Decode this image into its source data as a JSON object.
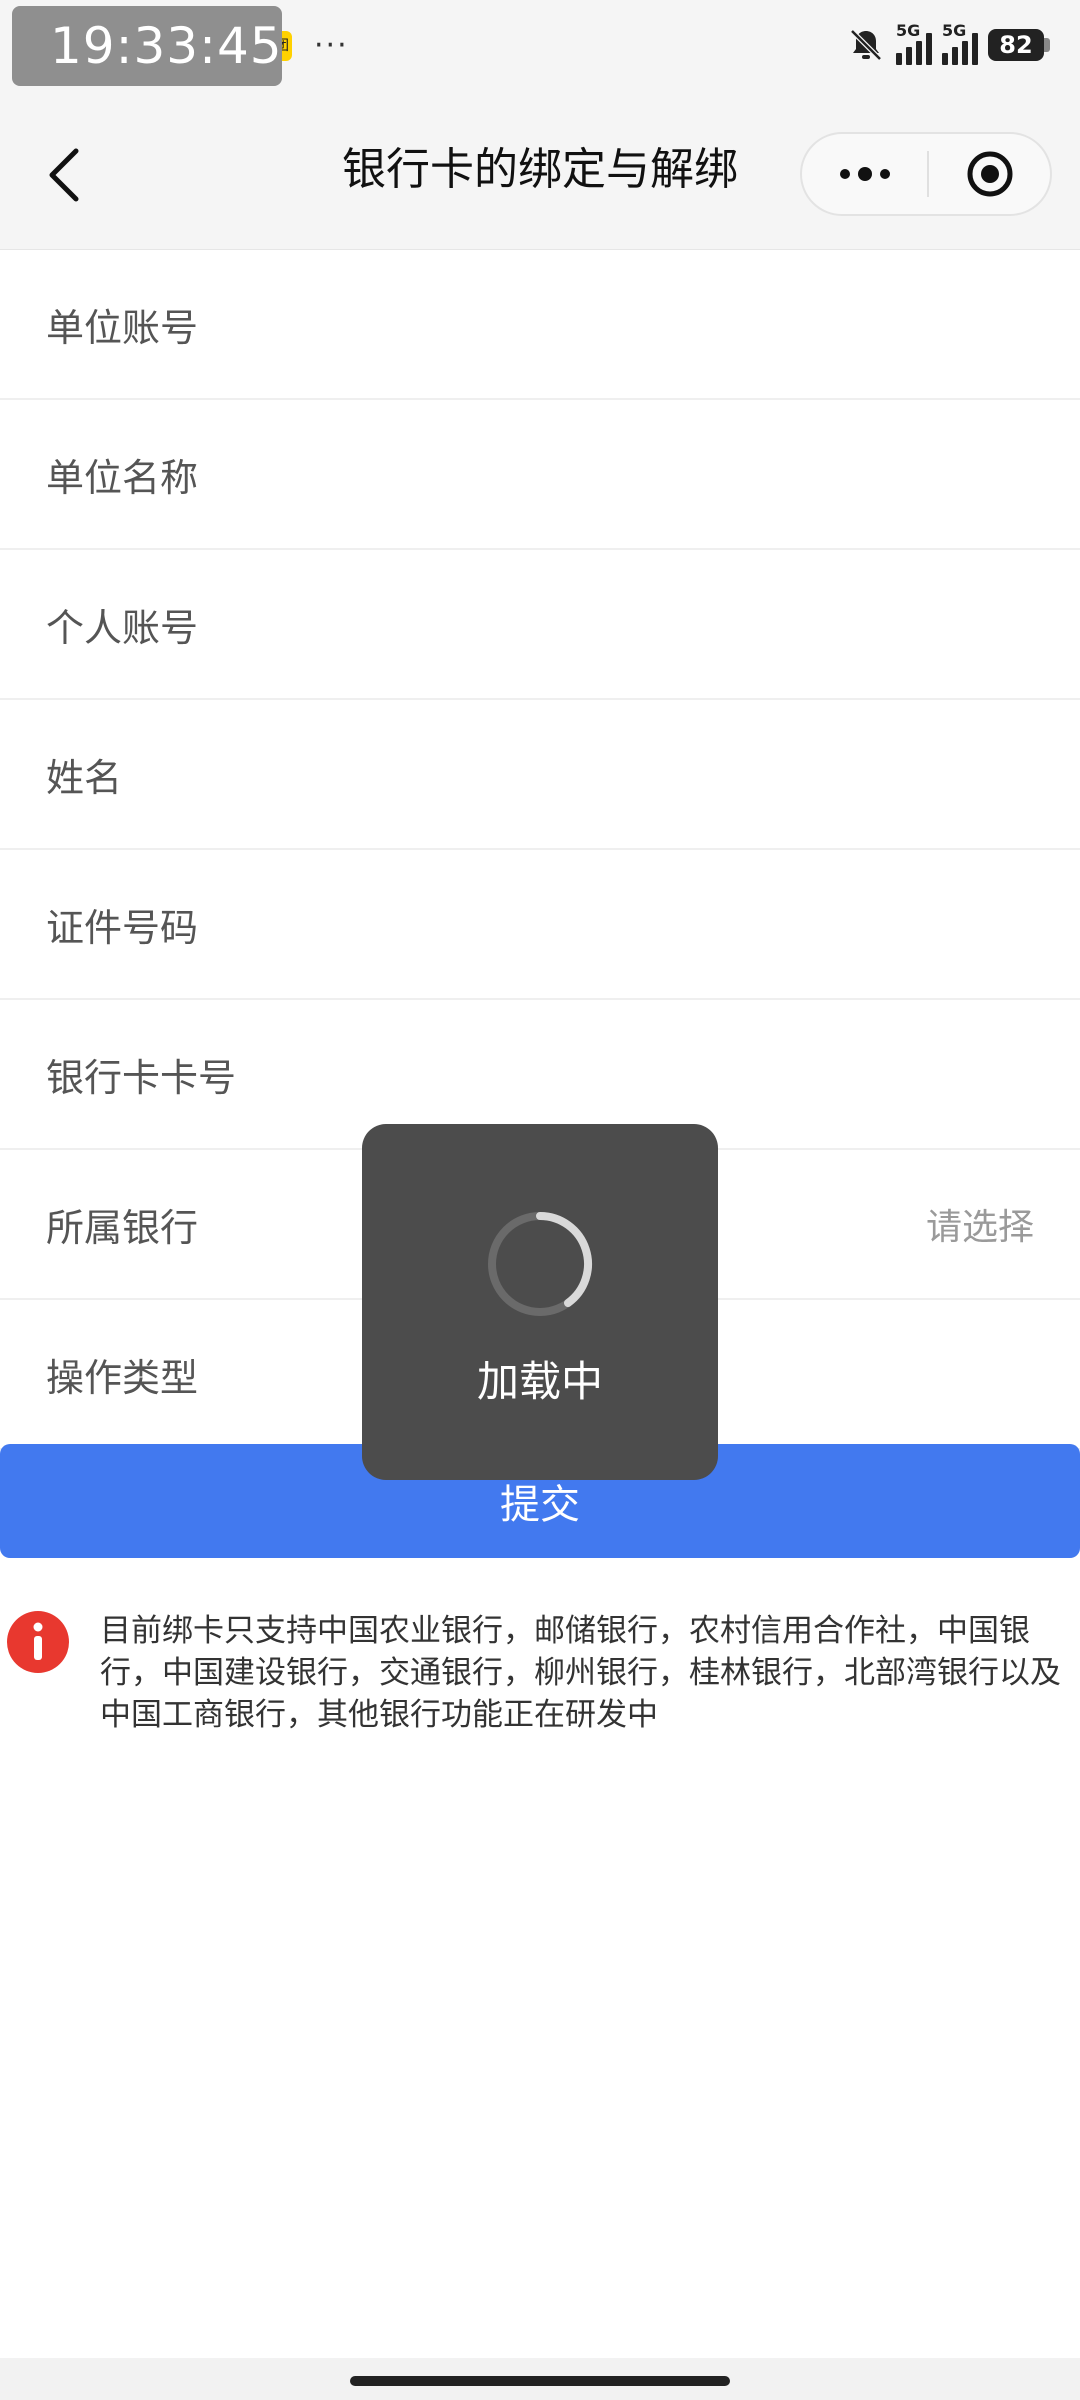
{
  "status_bar": {
    "time": "19:33:45",
    "meituan_label": "美团",
    "more": "···",
    "network_1": "5G",
    "network_2": "5G",
    "battery": "82"
  },
  "nav": {
    "title": "银行卡的绑定与解绑",
    "more_glyph": "•••"
  },
  "form": {
    "rows": [
      {
        "label": "单位账号",
        "value": ""
      },
      {
        "label": "单位名称",
        "value": ""
      },
      {
        "label": "个人账号",
        "value": ""
      },
      {
        "label": "姓名",
        "value": ""
      },
      {
        "label": "证件号码",
        "value": ""
      },
      {
        "label": "银行卡卡号",
        "value": ""
      },
      {
        "label": "所属银行",
        "value": "请选择"
      },
      {
        "label": "操作类型",
        "value": ""
      }
    ]
  },
  "submit": {
    "label": "提交"
  },
  "notice": {
    "text": "目前绑卡只支持中国农业银行，邮储银行，农村信用合作社，中国银行，中国建设银行，交通银行，柳州银行，桂林银行，北部湾银行以及中国工商银行，其他银行功能正在研发中"
  },
  "toast": {
    "text": "加载中"
  },
  "colors": {
    "primary": "#4279ef",
    "toast_bg": "#4c4c4c",
    "notice_icon": "#e8382f"
  }
}
